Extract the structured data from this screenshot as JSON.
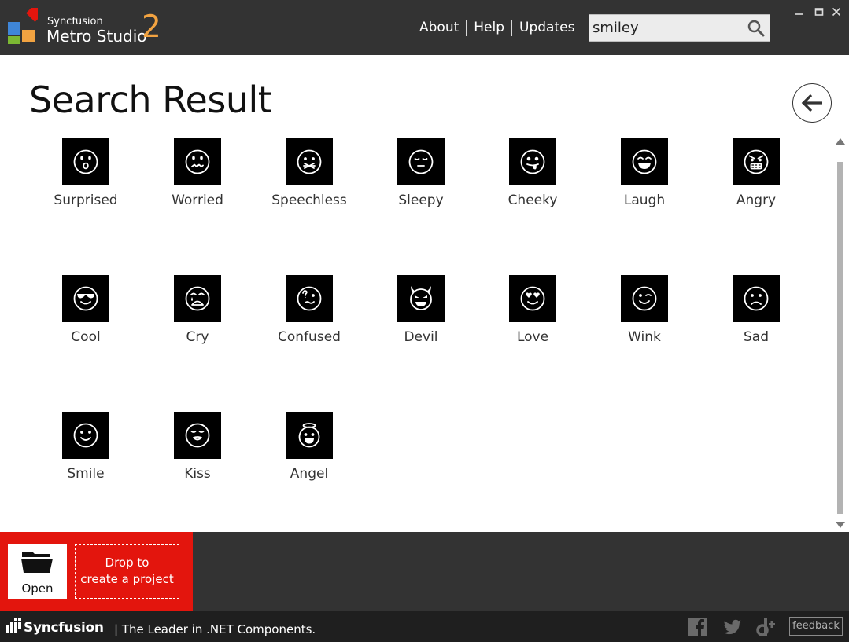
{
  "app": {
    "company": "Syncfusion",
    "product": "Metro Studio",
    "version": "2",
    "accent": "#f2a341",
    "header_bg": "#333333"
  },
  "nav": {
    "about": "About",
    "help": "Help",
    "updates": "Updates"
  },
  "search": {
    "value": "smiley",
    "icon": "search-icon"
  },
  "window_controls": [
    "minimize-icon",
    "maximize-icon",
    "close-icon"
  ],
  "main": {
    "title": "Search Result",
    "back_icon": "back-arrow-icon"
  },
  "icons": [
    {
      "label": "Surprised",
      "icon": "surprised"
    },
    {
      "label": "Worried",
      "icon": "worried"
    },
    {
      "label": "Speechless",
      "icon": "speechless"
    },
    {
      "label": "Sleepy",
      "icon": "sleepy"
    },
    {
      "label": "Cheeky",
      "icon": "cheeky"
    },
    {
      "label": "Laugh",
      "icon": "laugh"
    },
    {
      "label": "Angry",
      "icon": "angry"
    },
    {
      "label": "Cool",
      "icon": "cool"
    },
    {
      "label": "Cry",
      "icon": "cry"
    },
    {
      "label": "Confused",
      "icon": "confused"
    },
    {
      "label": "Devil",
      "icon": "devil"
    },
    {
      "label": "Love",
      "icon": "love"
    },
    {
      "label": "Wink",
      "icon": "wink"
    },
    {
      "label": "Sad",
      "icon": "sad"
    },
    {
      "label": "Smile",
      "icon": "smile"
    },
    {
      "label": "Kiss",
      "icon": "kiss"
    },
    {
      "label": "Angel",
      "icon": "angel"
    }
  ],
  "bottom": {
    "open_label": "Open",
    "drop_line1": "Drop to",
    "drop_line2": "create a project",
    "drop_bg": "#e3150d"
  },
  "footer": {
    "brand": "Syncfusion",
    "tagline": "| The Leader in .NET Components.",
    "feedback": "feedback",
    "social": [
      "facebook-icon",
      "twitter-icon",
      "delicious-icon"
    ]
  }
}
